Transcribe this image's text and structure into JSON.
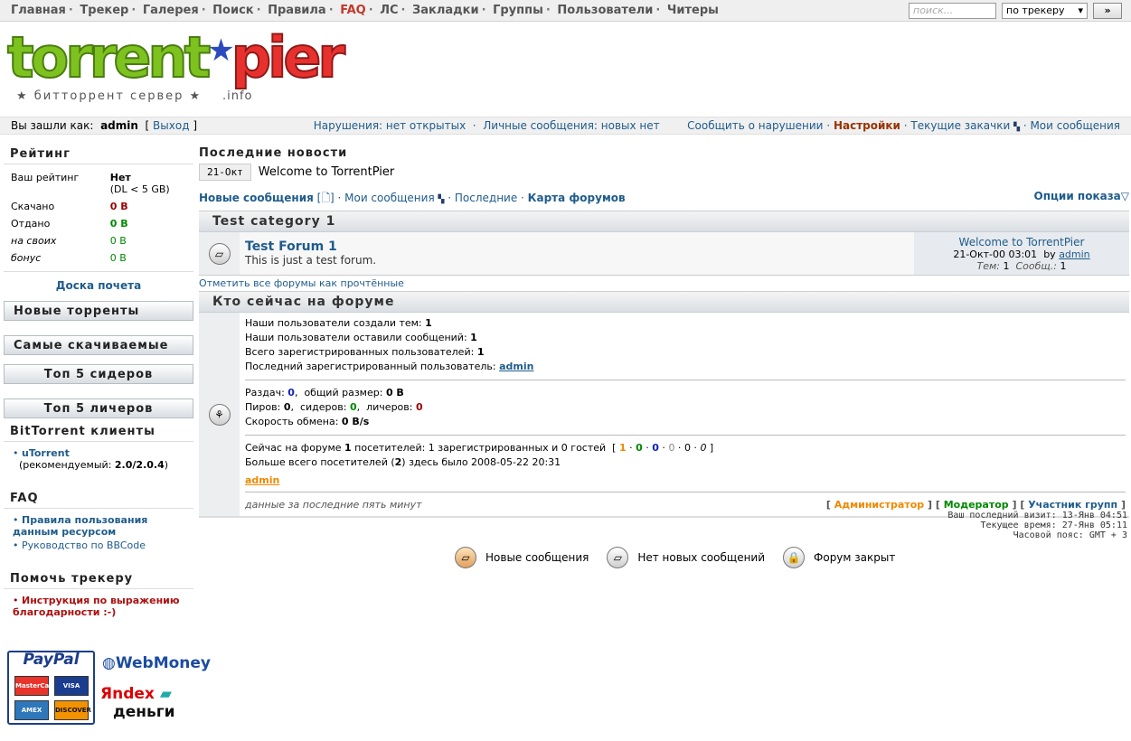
{
  "topnav": {
    "items": [
      "Главная",
      "Трекер",
      "Галерея",
      "Поиск",
      "Правила",
      "FAQ",
      "ЛС",
      "Закладки",
      "Группы",
      "Пользователи",
      "Читеры"
    ]
  },
  "search": {
    "placeholder": "поиск...",
    "scope": "по трекеру",
    "go": "»"
  },
  "logo": {
    "torrent": "torrent",
    "pier": "pier",
    "sub": "★ битторрент сервер ★",
    "info": ".info"
  },
  "userbar": {
    "prefix": "Вы зашли как:",
    "user": "admin",
    "logout": "Выход",
    "violations": "Нарушения: нет открытых",
    "pm": "Личные сообщения: новых нет",
    "report": "Сообщить о нарушении",
    "settings": "Настройки",
    "downloads": "Текущие закачки",
    "my_posts": "Мои сообщения"
  },
  "sidebar": {
    "rating_title": "Рейтинг",
    "rating": [
      {
        "label": "Ваш рейтинг",
        "value": "Нет",
        "note": "(DL < 5 GB)"
      },
      {
        "label": "Скачано",
        "value": "0 B"
      },
      {
        "label": "Отдано",
        "value": "0 B"
      },
      {
        "label": "на своих",
        "value": "0 B"
      },
      {
        "label": "бонус",
        "value": "0 B"
      }
    ],
    "doska": "Доска почета",
    "new_torrents": "Новые торренты",
    "most_downloaded": "Самые скачиваемые",
    "top_seeders": "Топ 5 сидеров",
    "top_leechers": "Топ 5 личеров",
    "clients_title": "BitTorrent клиенты",
    "client_name": "uTorrent",
    "client_note": "(рекомендуемый: ",
    "client_ver": "2.0/2.0.4",
    "client_close": ")",
    "faq_title": "FAQ",
    "faq_items": [
      "Правила пользования данным ресурсом",
      "Руководство по BBCode"
    ],
    "help_title": "Помочь трекеру",
    "help_item": "Инструкция по выражению благодарности :-)",
    "paypal": "PayPal",
    "webmoney": "WebMoney",
    "yandex": "Яndex",
    "dengi": "деньги",
    "cards": [
      "MasterCard",
      "VISA",
      "AMEX",
      "DISCOVER"
    ]
  },
  "main": {
    "news_title": "Последние новости",
    "news_date": "21-Окт",
    "news_text": "Welcome to TorrentPier",
    "links": {
      "new": "Новые сообщения",
      "my": "Мои сообщения",
      "latest": "Последние",
      "map": "Карта форумов",
      "options": "Опции показа"
    },
    "category": "Test category 1",
    "forum": {
      "name": "Test Forum 1",
      "desc": "This is just a test forum.",
      "last_title": "Welcome to TorrentPier",
      "last_date": "21-Окт-00 03:01",
      "by": "by",
      "author": "admin",
      "topics_label": "Тем:",
      "topics": "1",
      "posts_label": "Сообщ.:",
      "posts": "1"
    },
    "mark_read": "Отметить все форумы как прочтённые",
    "who_title": "Кто сейчас на форуме",
    "stats": [
      {
        "label": "Наши пользователи создали тем:",
        "value": "1"
      },
      {
        "label": "Наши пользователи оставили сообщений:",
        "value": "1"
      },
      {
        "label": "Всего зарегистрированных пользователей:",
        "value": "1"
      }
    ],
    "last_user_label": "Последний зарегистрированный пользователь:",
    "last_user": "admin",
    "tracker": {
      "releases_label": "Раздач:",
      "releases": "0",
      "size_label": "общий размер:",
      "size": "0 B",
      "peers_label": "Пиров:",
      "peers": "0",
      "seeders_label": "сидеров:",
      "seeders": "0",
      "leechers_label": "личеров:",
      "leechers": "0",
      "speed_label": "Скорость обмена:",
      "speed": "0 B/s"
    },
    "online": {
      "prefix": "Сейчас на форуме",
      "count": "1",
      "rest": "посетителей: 1 зарегистрированных и 0 гостей",
      "record_a": "Больше всего посетителей (",
      "record_n": "2",
      "record_b": ") здесь было 2008-05-22 20:31",
      "user": "admin",
      "c1": "1",
      "c2": "0",
      "c3": "0",
      "c4": "0",
      "c5": "0",
      "c6": "0"
    },
    "period": "данные за последние пять минут",
    "roles": {
      "admin": "Администратор",
      "mod": "Модератор",
      "group": "Участник групп"
    },
    "times": {
      "visit": "Ваш последний визит: 13-Янв 04:51",
      "now": "Текущее время: 27-Янв 05:11",
      "tz": "Часовой пояс: GMT + 3"
    },
    "legend": {
      "new": "Новые сообщения",
      "none": "Нет новых сообщений",
      "closed": "Форум закрыт"
    }
  },
  "colors": {
    "link": "#1f5c8c",
    "accent": "#993300",
    "green": "#008800",
    "red": "#990000",
    "orange": "#ee8800"
  }
}
